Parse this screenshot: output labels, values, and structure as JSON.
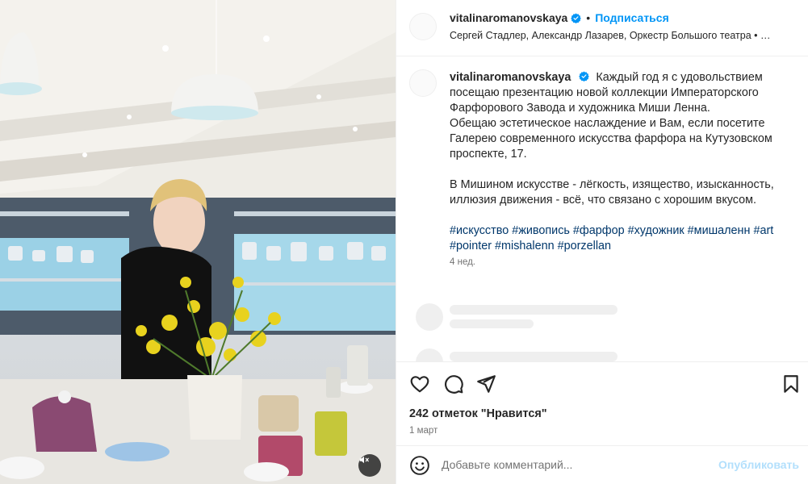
{
  "post_header": {
    "username": "vitalinaromanovskaya",
    "separator": "•",
    "follow_label": "Подписаться",
    "audio_line": "Сергей Стадлер, Александр Лазарев, Оркестр Большого театра • Л..."
  },
  "caption": {
    "username": "vitalinaromanovskaya",
    "paragraph1": "Каждый год я с удовольствием посещаю презентацию новой коллекции Императорского Фарфорового Завода и художника Миши Ленна.",
    "paragraph2": "Обещаю эстетическое наслаждение и Вам, если посетите Галерею современного искусства фарфора на Кутузовском проспекте, 17.",
    "paragraph3": "В Мишином искусстве - лёгкость, изящество, изысканность, иллюзия движения - всё, что связано с хорошим вкусом.",
    "hashtags": [
      "#искусство",
      "#живопись",
      "#фарфор",
      "#художник",
      "#мишаленн",
      "#art",
      "#pointer",
      "#mishalenn",
      "#porzellan"
    ],
    "time_ago": "4 нед."
  },
  "actions": {
    "likes": "242 отметок \"Нравится\"",
    "date": "1 март"
  },
  "comment": {
    "placeholder": "Добавьте комментарий...",
    "publish_label": "Опубликовать"
  },
  "icons": {
    "like": "heart-icon",
    "comment": "comment-icon",
    "share": "send-icon",
    "save": "bookmark-icon",
    "emoji": "emoji-icon",
    "mute": "speaker-muted-icon",
    "verified": "verified-badge-icon"
  },
  "colors": {
    "link_blue": "#0095f6",
    "hashtag": "#00376b",
    "verified": "#0095f6",
    "muted_text": "#737373",
    "publish_disabled": "#b2dffc"
  }
}
